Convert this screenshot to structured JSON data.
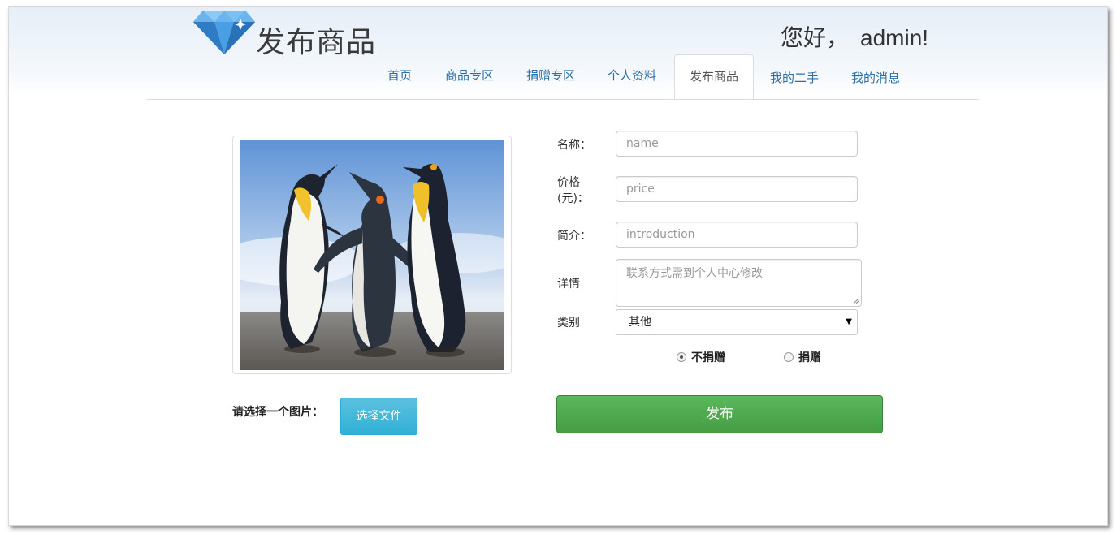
{
  "header": {
    "site_title": "发布商品",
    "greeting": "您好，",
    "username": "admin!"
  },
  "nav": {
    "tabs": [
      {
        "label": "首页"
      },
      {
        "label": "商品专区"
      },
      {
        "label": "捐赠专区"
      },
      {
        "label": "个人资料"
      },
      {
        "label": "发布商品",
        "active": true
      },
      {
        "label": "我的二手"
      },
      {
        "label": "我的消息"
      }
    ]
  },
  "image_upload": {
    "label": "请选择一个图片：",
    "button": "选择文件",
    "preview": "penguins-photo"
  },
  "form": {
    "name_label": "名称：",
    "name_placeholder": "name",
    "price_label_line1": "价格",
    "price_label_line2": "(元)：",
    "price_placeholder": "price",
    "intro_label": "简介：",
    "intro_placeholder": "introduction",
    "detail_label": "详情",
    "detail_placeholder": "联系方式需到个人中心修改",
    "category_label": "类别",
    "category_value": "其他",
    "radio_options": [
      {
        "label": "不捐赠",
        "checked": true
      },
      {
        "label": "捐赠",
        "checked": false
      }
    ],
    "submit": "发布"
  },
  "colors": {
    "nav_link": "#2a6fa8",
    "publish_green": "#5cb85c",
    "file_button_blue": "#5bc0de"
  }
}
